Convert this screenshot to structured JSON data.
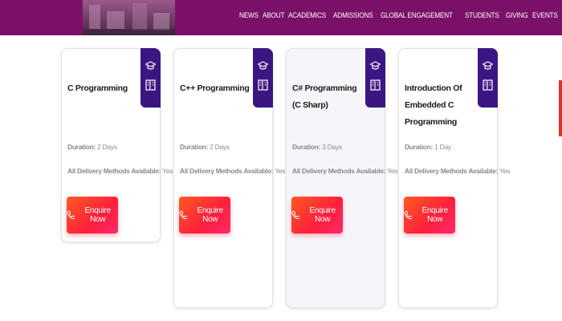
{
  "nav": {
    "items": [
      "NEWS",
      "ABOUT",
      "ACADEMICS",
      "ADMISSIONS",
      "GLOBAL ENGAGEMENT",
      "STUDENTS",
      "GIVING",
      "EVENTS"
    ]
  },
  "cards": [
    {
      "title": "C Programming",
      "duration_label": "Duration:",
      "duration_value": "2 Days",
      "delivery_label": "All Delivery Methods Available:",
      "delivery_value": "Yes",
      "button_label": "Enquire Now"
    },
    {
      "title": "C++ Programming",
      "duration_label": "Duration:",
      "duration_value": "2 Days",
      "delivery_label": "All Delivery Methods Available:",
      "delivery_value": "Yes",
      "button_label": "Enquire Now"
    },
    {
      "title": "C# Programming (C Sharp)",
      "duration_label": "Duration:",
      "duration_value": "3 Days",
      "delivery_label": "All Delivery Methods Available:",
      "delivery_value": "Yes",
      "button_label": "Enquire Now"
    },
    {
      "title": "Introduction Of Embedded C Programming",
      "duration_label": "Duration:",
      "duration_value": "1 Day",
      "delivery_label": "All Delivery Methods Available:",
      "delivery_value": "Yes",
      "button_label": "Enquire Now"
    }
  ],
  "colors": {
    "header": "#7b1068",
    "badge": "#3b1683",
    "button_start": "#ff5a1f",
    "button_end": "#ff1f3d"
  },
  "icons": {
    "badge_top": "graduation-cap-icon",
    "badge_bottom": "open-book-icon",
    "button": "phone-icon"
  }
}
